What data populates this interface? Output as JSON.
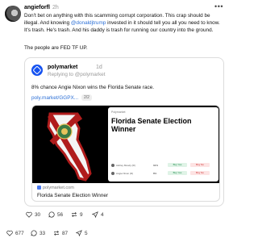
{
  "author": {
    "handle": "angieforfl",
    "timestamp": "2h",
    "more_label": "•••"
  },
  "post": {
    "text_before_mention": "Don't bet on anything with this scamming corrupt corporation. This crap should be illegal. And knowing ",
    "mention": "@donaldjtrump",
    "text_after_mention": " invested in it should tell you all you need to know. It's trash. He's trash. And his daddy is trash for running our country into the ground.",
    "second_paragraph": "The people are FED TF UP."
  },
  "quoted": {
    "handle": "polymarket",
    "timestamp": "1d",
    "reply_to": "Replying to @polymarket",
    "text": "8% chance Angie Nixon wins the Florida Senate race.",
    "link": "poly.market/GGPX...",
    "link_pager": "2/2",
    "card": {
      "mini_logo": "Polymarket",
      "mini_title": "Florida Senate Election Winner",
      "rows": [
        {
          "name": "Ashley Moody (R)",
          "pct": "92%",
          "yes": "Buy Yes",
          "no": "Buy No"
        },
        {
          "name": "Angie Nixon (D)",
          "pct": "8%",
          "yes": "Buy Yes",
          "no": "Buy No"
        }
      ],
      "domain": "polymarket.com",
      "title": "Florida Senate Election Winner"
    },
    "actions": {
      "likes": "30",
      "replies": "56",
      "reposts": "9",
      "shares": "4"
    }
  },
  "actions": {
    "likes": "677",
    "replies": "33",
    "reposts": "87",
    "shares": "5"
  },
  "colors": {
    "link": "#2b6fd6",
    "polymarket_blue": "#1552f0"
  }
}
